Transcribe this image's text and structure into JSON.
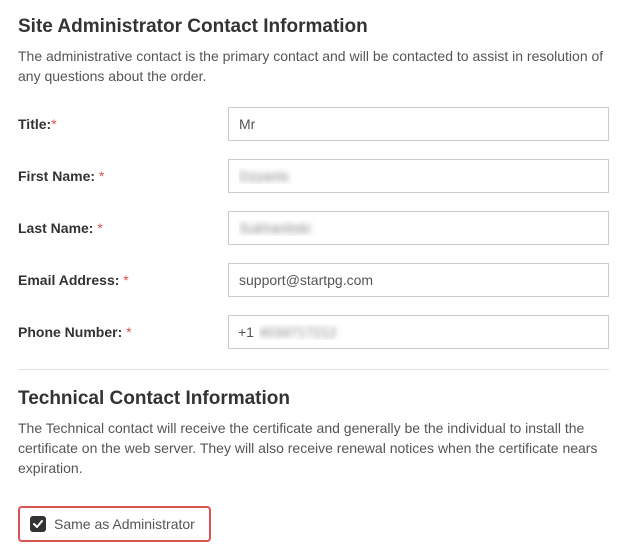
{
  "admin": {
    "heading": "Site Administrator Contact Information",
    "description": "The administrative contact is the primary contact and will be contacted to assist in resolution of any questions about the order.",
    "fields": {
      "title": {
        "label": "Title:",
        "value": "Mr"
      },
      "first_name": {
        "label": "First Name: ",
        "value": "Dzyanis"
      },
      "last_name": {
        "label": "Last Name: ",
        "value": "Sukhanitski"
      },
      "email": {
        "label": "Email Address: ",
        "value": "support@startpg.com"
      },
      "phone": {
        "label": "Phone Number: ",
        "prefix": "+1",
        "value": "4034717212"
      }
    },
    "required_marker": "*"
  },
  "technical": {
    "heading": "Technical Contact Information",
    "description": "The Technical contact will receive the certificate and generally be the individual to install the certificate on the web server. They will also receive renewal notices when the certificate nears expiration.",
    "same_as_admin": {
      "label": "Same as Administrator",
      "checked": true
    }
  }
}
